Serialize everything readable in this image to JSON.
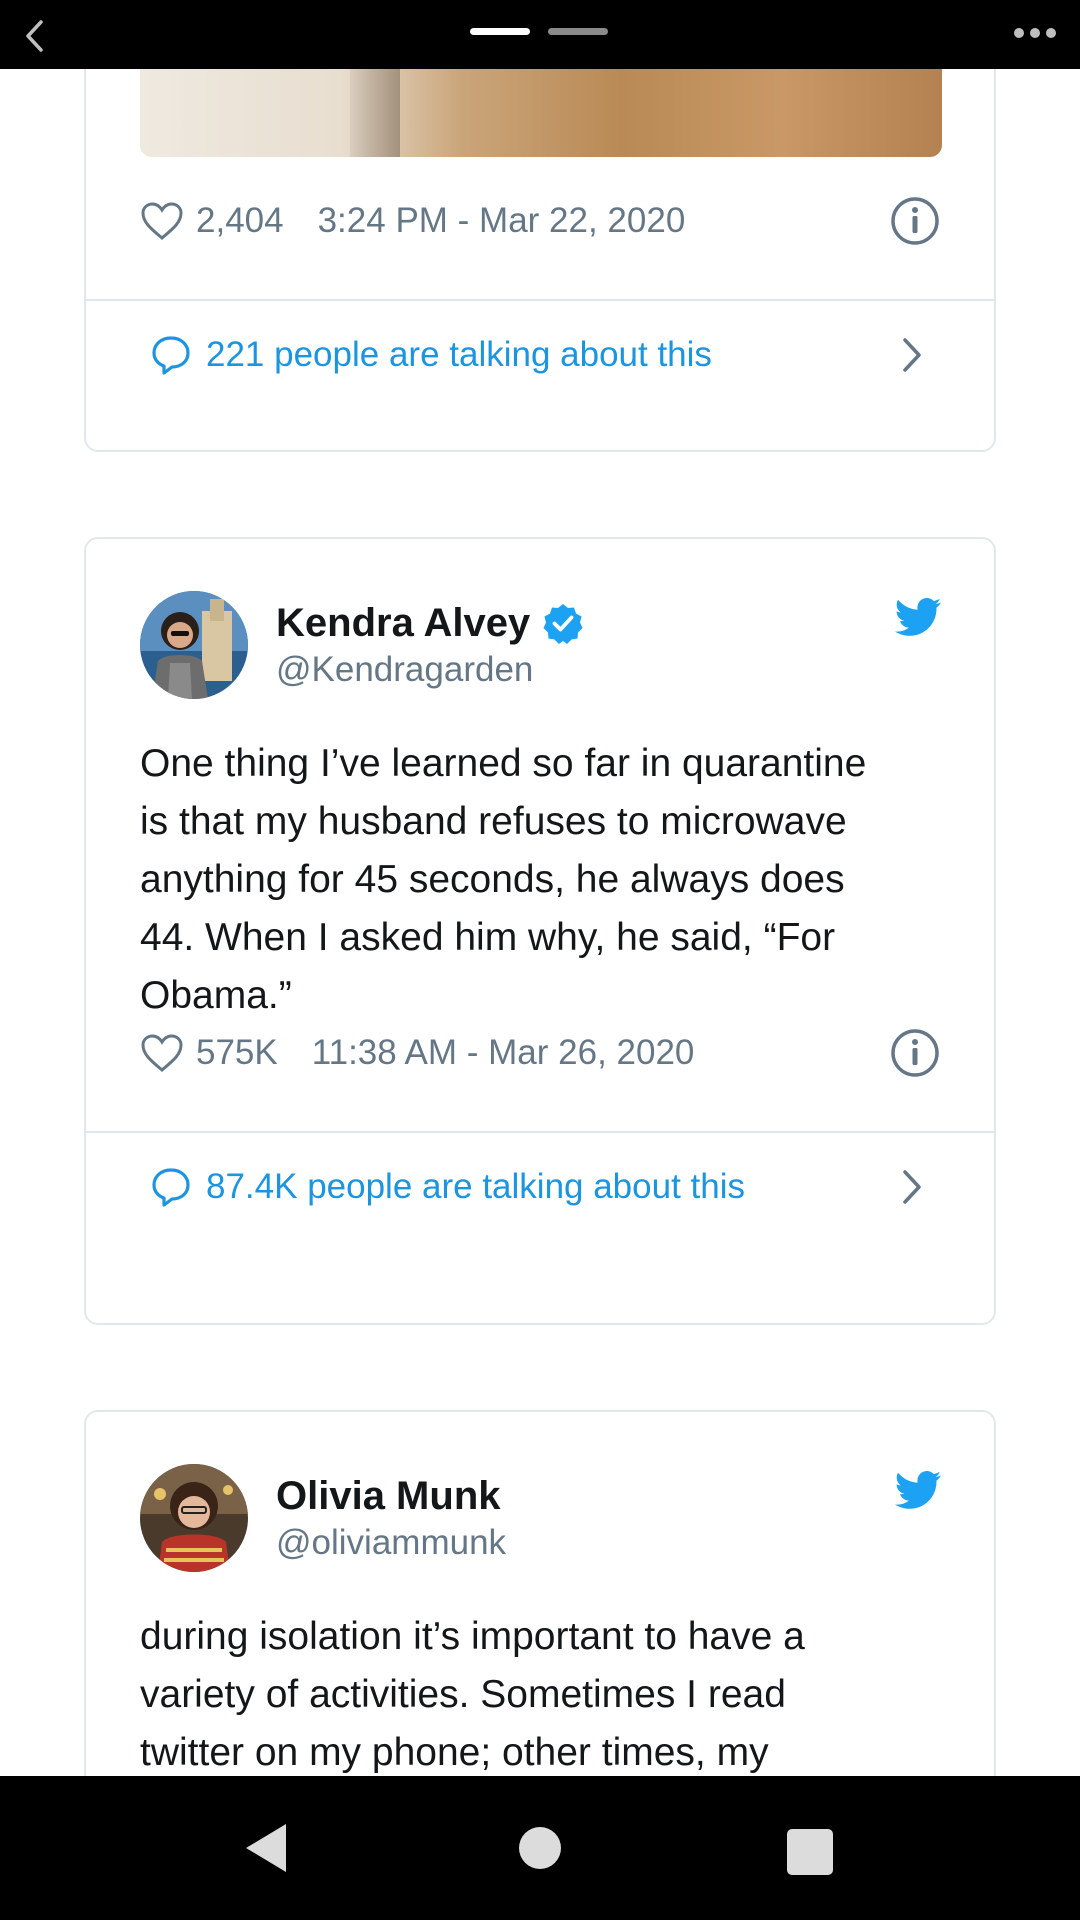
{
  "colors": {
    "link": "#1b95e0",
    "verified": "#1da1f2",
    "muted": "#657786",
    "border": "#e1e8ed"
  },
  "tweets": [
    {
      "likes": "2,404",
      "timestamp": "3:24 PM - Mar 22, 2020",
      "talking": "221 people are talking about this"
    },
    {
      "name": "Kendra Alvey",
      "verified": true,
      "handle": "@Kendragarden",
      "text": "One thing I’ve learned so far in quarantine\nis that my husband refuses to microwave\nanything for 45 seconds, he always does\n44. When I asked him why, he said, “For\nObama.”",
      "likes": "575K",
      "timestamp": "11:38 AM - Mar 26, 2020",
      "talking": "87.4K people are talking about this"
    },
    {
      "name": "Olivia Munk",
      "handle": "@oliviammunk",
      "text": "during isolation it’s important to have a\nvariety of activities. Sometimes I read\ntwitter on my phone; other times, my"
    }
  ],
  "icons": {
    "back": "chevron-left-icon",
    "more": "more-dots-icon",
    "like": "heart-icon",
    "info": "info-icon",
    "reply": "speech-bubble-icon",
    "open": "chevron-right-icon",
    "brand": "twitter-bird-icon",
    "verified": "verified-badge-icon"
  }
}
